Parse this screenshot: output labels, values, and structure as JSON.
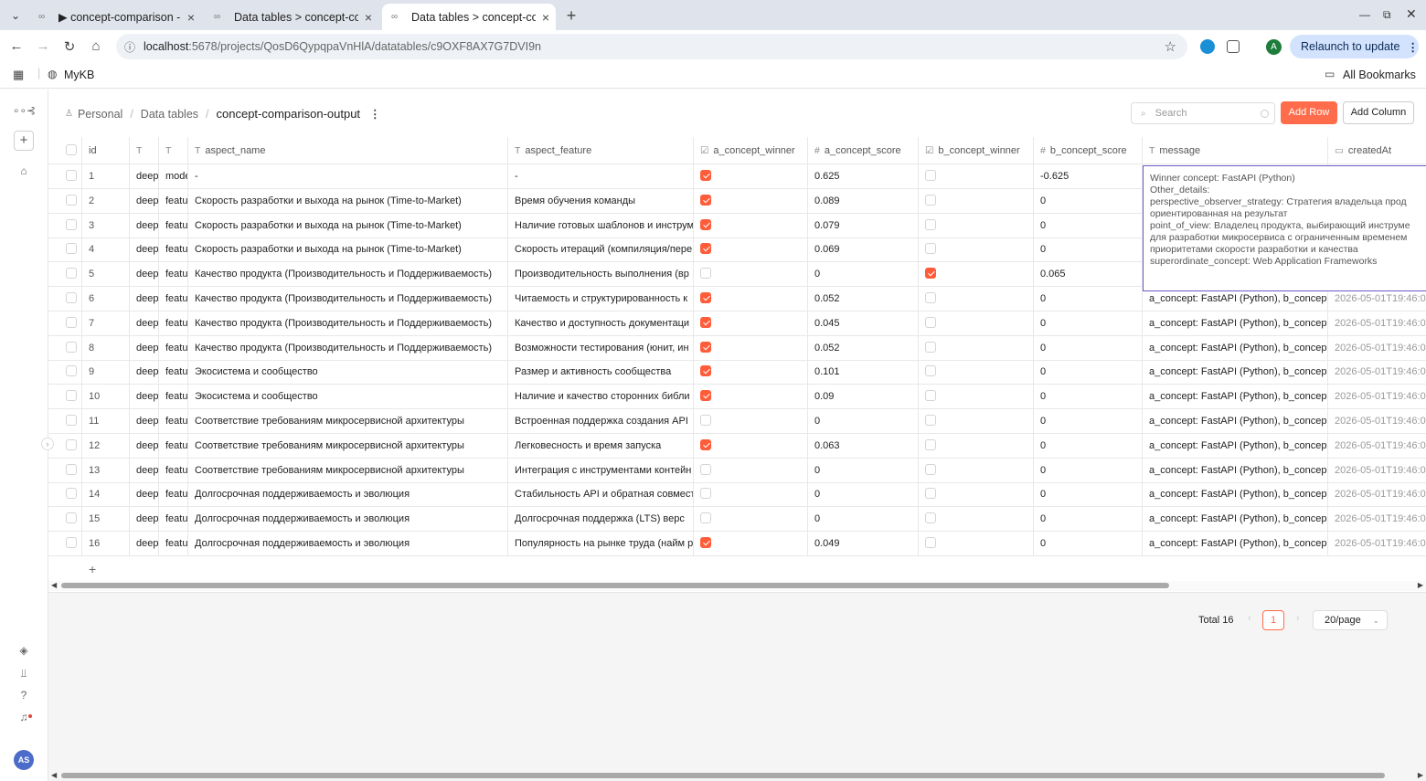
{
  "browser": {
    "tabs": [
      {
        "title": "▶ concept-comparison -",
        "active": false
      },
      {
        "title": "Data tables > concept-co",
        "active": false
      },
      {
        "title": "Data tables > concept-co",
        "active": true
      }
    ],
    "url_host": "localhost",
    "url_rest": ":5678/projects/QosD6QypqpaVnHlA/datatables/c9OXF8AX7G7DVI9n",
    "relaunch_label": "Relaunch to update",
    "profile_initial": "A",
    "bookmark_mykb": "MyKB",
    "all_bookmarks": "All Bookmarks"
  },
  "sidebar": {
    "user_initials": "AS"
  },
  "breadcrumb": {
    "root": "Personal",
    "section": "Data tables",
    "current": "concept-comparison-output"
  },
  "toolbar": {
    "search_placeholder": "Search",
    "add_row": "Add Row",
    "add_column": "Add Column"
  },
  "columns": [
    {
      "label": "id",
      "type": ""
    },
    {
      "label": "",
      "type": "T"
    },
    {
      "label": "",
      "type": "T"
    },
    {
      "label": "aspect_name",
      "type": "T"
    },
    {
      "label": "aspect_feature",
      "type": "T"
    },
    {
      "label": "a_concept_winner",
      "type": "☑"
    },
    {
      "label": "a_concept_score",
      "type": "#"
    },
    {
      "label": "b_concept_winner",
      "type": "☑"
    },
    {
      "label": "b_concept_score",
      "type": "#"
    },
    {
      "label": "message",
      "type": "T"
    },
    {
      "label": "createdAt",
      "type": "▭"
    }
  ],
  "rows": [
    {
      "id": "1",
      "c1": "deep",
      "c2": "mode",
      "aspect_name": "-",
      "aspect_feature": "-",
      "a_win": true,
      "a_score": "0.625",
      "b_win": false,
      "b_score": "-0.625",
      "message": "",
      "created": ""
    },
    {
      "id": "2",
      "c1": "deep",
      "c2": "featu",
      "aspect_name": "Скорость разработки и выхода на рынок (Time-to-Market)",
      "aspect_feature": "Время обучения команды",
      "a_win": true,
      "a_score": "0.089",
      "b_win": false,
      "b_score": "0",
      "message": "",
      "created": ""
    },
    {
      "id": "3",
      "c1": "deep",
      "c2": "featu",
      "aspect_name": "Скорость разработки и выхода на рынок (Time-to-Market)",
      "aspect_feature": "Наличие готовых шаблонов и инструм",
      "a_win": true,
      "a_score": "0.079",
      "b_win": false,
      "b_score": "0",
      "message": "",
      "created": ""
    },
    {
      "id": "4",
      "c1": "deep",
      "c2": "featu",
      "aspect_name": "Скорость разработки и выхода на рынок (Time-to-Market)",
      "aspect_feature": "Скорость итераций (компиляция/пере",
      "a_win": true,
      "a_score": "0.069",
      "b_win": false,
      "b_score": "0",
      "message": "",
      "created": ""
    },
    {
      "id": "5",
      "c1": "deep",
      "c2": "featu",
      "aspect_name": "Качество продукта (Производительность и Поддерживаемость)",
      "aspect_feature": "Производительность выполнения (вр",
      "a_win": false,
      "a_score": "0",
      "b_win": true,
      "b_score": "0.065",
      "message": "",
      "created": ""
    },
    {
      "id": "6",
      "c1": "deep",
      "c2": "featu",
      "aspect_name": "Качество продукта (Производительность и Поддерживаемость)",
      "aspect_feature": "Читаемость и структурированность к",
      "a_win": true,
      "a_score": "0.052",
      "b_win": false,
      "b_score": "0",
      "message": "a_concept: FastAPI (Python), b_concep",
      "created": "2026-05-01T19:46:0"
    },
    {
      "id": "7",
      "c1": "deep",
      "c2": "featu",
      "aspect_name": "Качество продукта (Производительность и Поддерживаемость)",
      "aspect_feature": "Качество и доступность документаци",
      "a_win": true,
      "a_score": "0.045",
      "b_win": false,
      "b_score": "0",
      "message": "a_concept: FastAPI (Python), b_concep",
      "created": "2026-05-01T19:46:0"
    },
    {
      "id": "8",
      "c1": "deep",
      "c2": "featu",
      "aspect_name": "Качество продукта (Производительность и Поддерживаемость)",
      "aspect_feature": "Возможности тестирования (юнит, ин",
      "a_win": true,
      "a_score": "0.052",
      "b_win": false,
      "b_score": "0",
      "message": "a_concept: FastAPI (Python), b_concep",
      "created": "2026-05-01T19:46:0"
    },
    {
      "id": "9",
      "c1": "deep",
      "c2": "featu",
      "aspect_name": "Экосистема и сообщество",
      "aspect_feature": "Размер и активность сообщества",
      "a_win": true,
      "a_score": "0.101",
      "b_win": false,
      "b_score": "0",
      "message": "a_concept: FastAPI (Python), b_concep",
      "created": "2026-05-01T19:46:0"
    },
    {
      "id": "10",
      "c1": "deep",
      "c2": "featu",
      "aspect_name": "Экосистема и сообщество",
      "aspect_feature": "Наличие и качество сторонних библи",
      "a_win": true,
      "a_score": "0.09",
      "b_win": false,
      "b_score": "0",
      "message": "a_concept: FastAPI (Python), b_concep",
      "created": "2026-05-01T19:46:0"
    },
    {
      "id": "11",
      "c1": "deep",
      "c2": "featu",
      "aspect_name": "Соответствие требованиям микросервисной архитектуры",
      "aspect_feature": "Встроенная поддержка создания API",
      "a_win": false,
      "a_score": "0",
      "b_win": false,
      "b_score": "0",
      "message": "a_concept: FastAPI (Python), b_concep",
      "created": "2026-05-01T19:46:0"
    },
    {
      "id": "12",
      "c1": "deep",
      "c2": "featu",
      "aspect_name": "Соответствие требованиям микросервисной архитектуры",
      "aspect_feature": "Легковесность и время запуска",
      "a_win": true,
      "a_score": "0.063",
      "b_win": false,
      "b_score": "0",
      "message": "a_concept: FastAPI (Python), b_concep",
      "created": "2026-05-01T19:46:0"
    },
    {
      "id": "13",
      "c1": "deep",
      "c2": "featu",
      "aspect_name": "Соответствие требованиям микросервисной архитектуры",
      "aspect_feature": "Интеграция с инструментами контейн",
      "a_win": false,
      "a_score": "0",
      "b_win": false,
      "b_score": "0",
      "message": "a_concept: FastAPI (Python), b_concep",
      "created": "2026-05-01T19:46:0"
    },
    {
      "id": "14",
      "c1": "deep",
      "c2": "featu",
      "aspect_name": "Долгосрочная поддерживаемость и эволюция",
      "aspect_feature": "Стабильность API и обратная совмест",
      "a_win": false,
      "a_score": "0",
      "b_win": false,
      "b_score": "0",
      "message": "a_concept: FastAPI (Python), b_concep",
      "created": "2026-05-01T19:46:0"
    },
    {
      "id": "15",
      "c1": "deep",
      "c2": "featu",
      "aspect_name": "Долгосрочная поддерживаемость и эволюция",
      "aspect_feature": "Долгосрочная поддержка (LTS) верс",
      "a_win": false,
      "a_score": "0",
      "b_win": false,
      "b_score": "0",
      "message": "a_concept: FastAPI (Python), b_concep",
      "created": "2026-05-01T19:46:0"
    },
    {
      "id": "16",
      "c1": "deep",
      "c2": "featu",
      "aspect_name": "Долгосрочная поддерживаемость и эволюция",
      "aspect_feature": "Популярность на рынке труда (найм р",
      "a_win": true,
      "a_score": "0.049",
      "b_win": false,
      "b_score": "0",
      "message": "a_concept: FastAPI (Python), b_concep",
      "created": "2026-05-01T19:46:0"
    }
  ],
  "message_editor": {
    "text": "Winner concept: FastAPI (Python)\nOther_details:\nperspective_observer_strategy: Стратегия владельца прод\nориентированная на результат\npoint_of_view: Владелец продукта, выбирающий инструме\nдля разработки микросервиса с ограниченным временем\nприоритетами скорости разработки и качества\nsuperordinate_concept: Web Application Frameworks"
  },
  "pagination": {
    "total": "Total 16",
    "current_page": "1",
    "page_size": "20/page"
  },
  "colors": {
    "accent": "#ff6c4b",
    "editor_border": "#6a5acd"
  }
}
